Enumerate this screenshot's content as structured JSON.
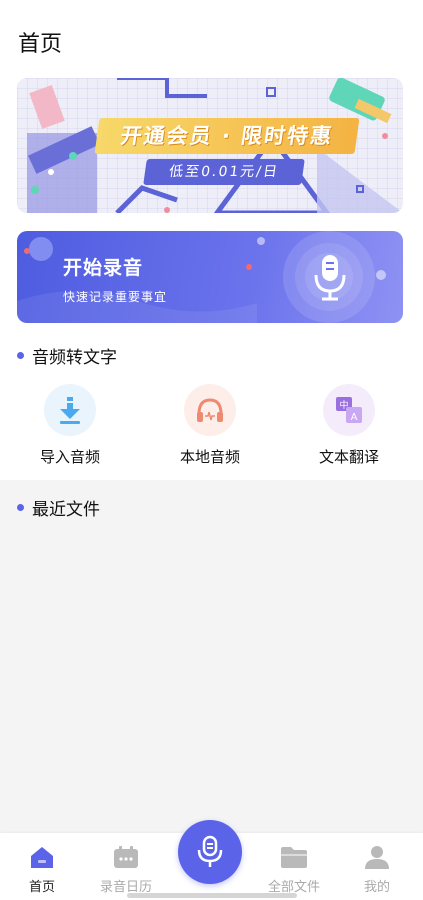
{
  "header": {
    "title": "首页"
  },
  "promo_banner": {
    "title": "开通会员 · 限时特惠",
    "price_text": "低至0.01元/日"
  },
  "record_banner": {
    "title": "开始录音",
    "subtitle": "快速记录重要事宜"
  },
  "audio_to_text": {
    "section_title": "音频转文字",
    "tools": [
      {
        "label": "导入音频",
        "icon": "import-download-icon"
      },
      {
        "label": "本地音频",
        "icon": "headphones-icon"
      },
      {
        "label": "文本翻译",
        "icon": "translate-icon"
      }
    ]
  },
  "recent_files": {
    "section_title": "最近文件"
  },
  "tabbar": {
    "tabs": [
      {
        "label": "首页",
        "icon": "home-icon",
        "active": true
      },
      {
        "label": "录音日历",
        "icon": "calendar-icon",
        "active": false
      },
      {
        "label": "全部文件",
        "icon": "folder-icon",
        "active": false
      },
      {
        "label": "我的",
        "icon": "user-icon",
        "active": false
      }
    ],
    "center_button_icon": "microphone-icon"
  },
  "colors": {
    "accent": "#5b63e8",
    "active_tab": "#5b63e8",
    "inactive_tab": "#aaaaaa",
    "promo_title": "#f4b343"
  }
}
